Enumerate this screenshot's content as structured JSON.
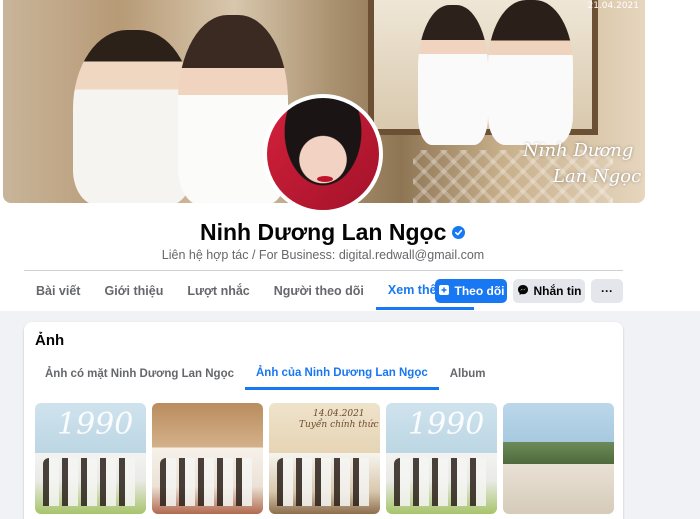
{
  "cover": {
    "date_text": "21.04.2021",
    "signature_line1": "Ninh Dương",
    "signature_line2": "Lan Ngọc"
  },
  "profile": {
    "name": "Ninh Dương Lan Ngọc",
    "subtitle": "Liên hệ hợp tác / For Business: digital.redwall@gmail.com",
    "verified_icon": "verified-check-icon"
  },
  "tabs": [
    {
      "label": "Bài viết"
    },
    {
      "label": "Giới thiệu"
    },
    {
      "label": "Lượt nhắc"
    },
    {
      "label": "Người theo dõi"
    },
    {
      "label": "Xem thêm"
    }
  ],
  "actions": {
    "follow_label": "Theo dõi",
    "message_label": "Nhắn tin",
    "more_label": "···"
  },
  "photos": {
    "title": "Ảnh",
    "tabs": [
      {
        "label": "Ảnh có mặt Ninh Dương Lan Ngọc"
      },
      {
        "label": "Ảnh của Ninh Dương Lan Ngọc"
      },
      {
        "label": "Album"
      }
    ],
    "thumb_text": {
      "p1": "1990",
      "p3_line1": "14.04.2021",
      "p3_line2": "Tuyển chính thức",
      "p4": "1990"
    }
  },
  "colors": {
    "accent": "#1877f2",
    "secondary_text": "#65676b",
    "button_gray": "#e4e6eb",
    "page_bg": "#f0f2f5"
  }
}
